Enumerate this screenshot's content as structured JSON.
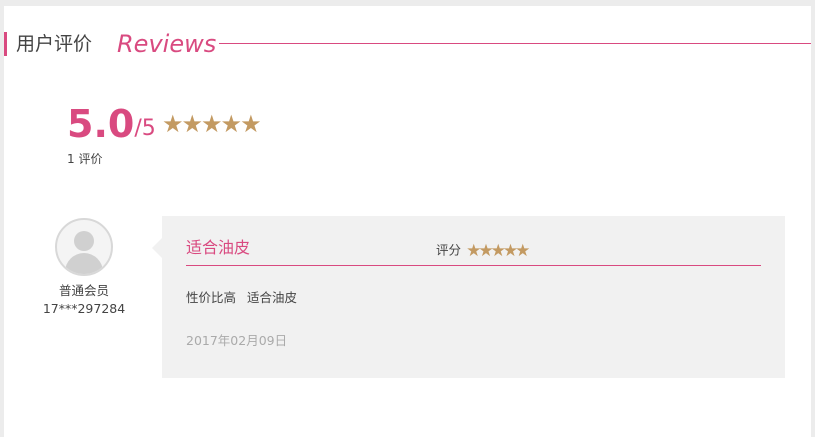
{
  "header": {
    "title_cn": "用户评价",
    "title_en": "Reviews",
    "accent_color": "#d94a80"
  },
  "summary": {
    "score": "5.0",
    "max": "/5",
    "stars": 5,
    "count_text": "1 评价"
  },
  "reviews": [
    {
      "user_type": "普通会员",
      "user_id": "17***297284",
      "title": "适合油皮",
      "rating_label": "评分",
      "stars": 5,
      "tags": [
        "性价比高",
        "适合油皮"
      ],
      "date": "2017年02月09日"
    }
  ],
  "colors": {
    "accent": "#d94a80",
    "star": "#c39a62",
    "bubble_bg": "#f1f1f1"
  },
  "icons": {
    "star": "star-icon",
    "avatar": "user-avatar-icon"
  }
}
